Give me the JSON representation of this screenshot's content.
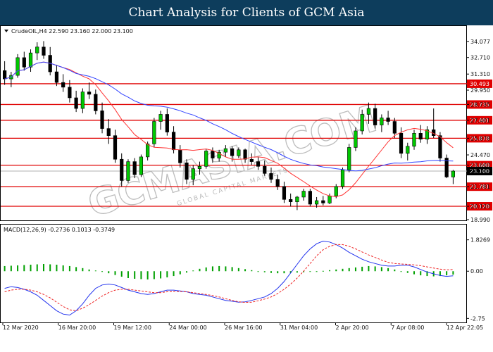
{
  "banner": {
    "title": "Chart Analysis for Clients of GCM Asia"
  },
  "chart_data": {
    "type": "candlestick",
    "symbol_header": "CrudeOIL,H4  22.590 23.160 22.000 23.100",
    "indicator_header": "MACD(12,26,9) -0.2736 0.1013 -0.3749",
    "watermark": "GCMASIA.COM",
    "watermark_sub": "GLOBAL CAPITAL MARKETS",
    "price_axis_ticks": [
      "34.077",
      "32.710",
      "31.310",
      "29.950",
      "28.735",
      "27.401",
      "25.878",
      "24.470",
      "23.600",
      "23.100",
      "21.781",
      "20.120",
      "18.990"
    ],
    "macd_axis_ticks": [
      "1.8269",
      "0.00",
      "-2.75"
    ],
    "x_tick_labels": [
      "12 Mar 2020",
      "16 Mar 20:00",
      "19 Mar 12:00",
      "24 Mar 00:00",
      "26 Mar 16:00",
      "31 Mar 04:00",
      "2 Apr 20:00",
      "7 Apr 08:00",
      "12 Apr 22:05"
    ],
    "ylim": [
      18.99,
      34.6
    ],
    "macd_ylim": [
      -2.9,
      2.1
    ],
    "horizontal_levels": [
      {
        "value": 30.493,
        "label": "30.493"
      },
      {
        "value": 28.735,
        "label": "28.735"
      },
      {
        "value": 27.401,
        "label": "27.401"
      },
      {
        "value": 25.878,
        "label": "25.878"
      },
      {
        "value": 23.6,
        "label": "23.600"
      },
      {
        "value": 21.781,
        "label": "21.781"
      },
      {
        "value": 20.12,
        "label": "20.120"
      }
    ],
    "current_price": {
      "value": 23.1,
      "label": "23.100"
    },
    "candles": [
      [
        31.6,
        32.4,
        30.4,
        30.9
      ],
      [
        30.9,
        31.5,
        30.2,
        31.2
      ],
      [
        31.2,
        33.0,
        31.0,
        32.7
      ],
      [
        32.7,
        33.2,
        31.6,
        31.9
      ],
      [
        31.9,
        33.4,
        31.5,
        33.1
      ],
      [
        33.1,
        34.0,
        32.5,
        33.6
      ],
      [
        33.6,
        34.1,
        32.6,
        32.9
      ],
      [
        32.9,
        33.6,
        31.2,
        31.5
      ],
      [
        31.5,
        32.1,
        30.3,
        30.6
      ],
      [
        30.6,
        31.3,
        29.8,
        30.2
      ],
      [
        30.2,
        30.8,
        28.9,
        29.3
      ],
      [
        29.3,
        29.9,
        28.1,
        28.4
      ],
      [
        28.4,
        30.1,
        28.0,
        29.8
      ],
      [
        29.8,
        30.6,
        29.2,
        29.6
      ],
      [
        29.6,
        30.0,
        27.9,
        28.2
      ],
      [
        28.2,
        28.9,
        26.3,
        26.7
      ],
      [
        26.7,
        27.5,
        25.4,
        26.1
      ],
      [
        26.1,
        26.6,
        23.8,
        24.1
      ],
      [
        24.1,
        24.6,
        21.8,
        22.3
      ],
      [
        22.3,
        24.1,
        22.1,
        23.9
      ],
      [
        23.9,
        24.2,
        22.5,
        22.8
      ],
      [
        22.8,
        24.5,
        22.6,
        24.3
      ],
      [
        24.3,
        25.6,
        24.0,
        25.4
      ],
      [
        25.4,
        27.6,
        25.1,
        27.3
      ],
      [
        27.3,
        28.2,
        26.6,
        27.9
      ],
      [
        27.9,
        28.4,
        26.1,
        26.4
      ],
      [
        26.4,
        26.9,
        24.6,
        24.9
      ],
      [
        24.9,
        25.3,
        23.4,
        23.8
      ],
      [
        23.8,
        24.1,
        22.0,
        22.4
      ],
      [
        22.4,
        23.6,
        21.9,
        23.3
      ],
      [
        23.3,
        23.9,
        22.8,
        23.5
      ],
      [
        23.5,
        25.0,
        23.3,
        24.8
      ],
      [
        24.8,
        25.1,
        23.8,
        24.2
      ],
      [
        24.2,
        24.9,
        23.9,
        24.7
      ],
      [
        24.7,
        25.3,
        24.3,
        25.0
      ],
      [
        25.0,
        25.2,
        23.9,
        24.4
      ],
      [
        24.4,
        25.1,
        24.2,
        24.9
      ],
      [
        24.9,
        25.0,
        23.8,
        24.1
      ],
      [
        24.1,
        24.6,
        23.6,
        23.9
      ],
      [
        23.9,
        24.3,
        23.2,
        23.5
      ],
      [
        23.5,
        24.0,
        22.7,
        22.9
      ],
      [
        22.9,
        23.4,
        22.1,
        22.4
      ],
      [
        22.4,
        22.8,
        21.5,
        21.8
      ],
      [
        21.8,
        22.2,
        20.4,
        20.7
      ],
      [
        20.7,
        21.2,
        20.1,
        20.5
      ],
      [
        20.5,
        21.0,
        19.8,
        20.9
      ],
      [
        20.9,
        21.6,
        20.6,
        21.4
      ],
      [
        21.4,
        21.6,
        20.1,
        20.3
      ],
      [
        20.3,
        20.9,
        20.0,
        20.6
      ],
      [
        20.6,
        21.0,
        20.2,
        20.4
      ],
      [
        20.4,
        21.2,
        20.3,
        21.0
      ],
      [
        21.0,
        22.0,
        20.8,
        21.8
      ],
      [
        21.8,
        23.4,
        21.6,
        23.2
      ],
      [
        23.2,
        25.4,
        23.0,
        25.1
      ],
      [
        25.1,
        26.8,
        24.8,
        26.5
      ],
      [
        26.5,
        28.3,
        26.2,
        27.9
      ],
      [
        27.9,
        28.9,
        27.1,
        28.4
      ],
      [
        28.4,
        28.8,
        26.7,
        27.0
      ],
      [
        27.0,
        27.9,
        26.4,
        27.6
      ],
      [
        27.6,
        28.2,
        27.0,
        27.3
      ],
      [
        27.3,
        27.6,
        25.9,
        26.3
      ],
      [
        26.3,
        26.8,
        24.2,
        24.6
      ],
      [
        24.6,
        25.5,
        24.0,
        25.2
      ],
      [
        25.2,
        26.6,
        24.9,
        26.3
      ],
      [
        26.3,
        27.0,
        25.5,
        25.8
      ],
      [
        25.8,
        26.9,
        25.4,
        26.6
      ],
      [
        26.6,
        28.4,
        25.9,
        26.1
      ],
      [
        26.1,
        26.4,
        23.9,
        24.2
      ],
      [
        24.2,
        24.5,
        22.5,
        22.6
      ],
      [
        22.6,
        23.2,
        22.0,
        23.1
      ]
    ],
    "moving_averages": [
      {
        "color": "#ff3333",
        "period": 10
      },
      {
        "color": "#3344ff",
        "period": 30
      }
    ],
    "macd_histogram": [
      0.3,
      0.32,
      0.34,
      0.36,
      0.38,
      0.4,
      0.42,
      0.4,
      0.38,
      0.34,
      0.3,
      0.24,
      0.18,
      0.1,
      0.04,
      -0.04,
      -0.12,
      -0.22,
      -0.32,
      -0.4,
      -0.44,
      -0.46,
      -0.48,
      -0.46,
      -0.42,
      -0.36,
      -0.28,
      -0.18,
      -0.08,
      0.04,
      0.14,
      0.22,
      0.28,
      0.3,
      0.28,
      0.24,
      0.18,
      0.12,
      0.06,
      0.0,
      -0.06,
      -0.1,
      -0.12,
      -0.12,
      -0.1,
      -0.08,
      -0.06,
      -0.04,
      -0.02,
      0.02,
      0.06,
      0.1,
      0.14,
      0.18,
      0.22,
      0.26,
      0.3,
      0.28,
      0.24,
      0.18,
      0.1,
      0.0,
      -0.1,
      -0.18,
      -0.24,
      -0.28,
      -0.3,
      -0.28,
      -0.24,
      -0.2
    ],
    "macd_line": [
      -1.0,
      -0.9,
      -0.95,
      -1.05,
      -1.2,
      -1.4,
      -1.7,
      -2.0,
      -2.3,
      -2.5,
      -2.55,
      -2.3,
      -1.9,
      -1.4,
      -1.0,
      -0.8,
      -0.75,
      -0.8,
      -0.95,
      -1.1,
      -1.2,
      -1.3,
      -1.35,
      -1.3,
      -1.2,
      -1.1,
      -1.1,
      -1.15,
      -1.2,
      -1.3,
      -1.35,
      -1.4,
      -1.5,
      -1.6,
      -1.7,
      -1.75,
      -1.8,
      -1.78,
      -1.7,
      -1.6,
      -1.5,
      -1.3,
      -1.0,
      -0.6,
      -0.1,
      0.4,
      0.9,
      1.3,
      1.6,
      1.75,
      1.7,
      1.55,
      1.35,
      1.1,
      0.9,
      0.7,
      0.55,
      0.45,
      0.35,
      0.3,
      0.3,
      0.35,
      0.35,
      0.25,
      0.1,
      -0.05,
      -0.15,
      -0.25,
      -0.3,
      -0.27
    ],
    "signal_line": [
      -1.2,
      -1.1,
      -1.05,
      -1.05,
      -1.1,
      -1.2,
      -1.35,
      -1.55,
      -1.8,
      -2.05,
      -2.25,
      -2.3,
      -2.15,
      -1.95,
      -1.7,
      -1.45,
      -1.25,
      -1.1,
      -1.05,
      -1.05,
      -1.1,
      -1.15,
      -1.2,
      -1.25,
      -1.25,
      -1.2,
      -1.18,
      -1.18,
      -1.2,
      -1.25,
      -1.3,
      -1.35,
      -1.42,
      -1.5,
      -1.6,
      -1.7,
      -1.78,
      -1.82,
      -1.8,
      -1.72,
      -1.62,
      -1.5,
      -1.3,
      -1.05,
      -0.75,
      -0.4,
      0.0,
      0.45,
      0.9,
      1.25,
      1.45,
      1.55,
      1.55,
      1.45,
      1.3,
      1.12,
      0.95,
      0.8,
      0.65,
      0.52,
      0.45,
      0.42,
      0.4,
      0.37,
      0.32,
      0.25,
      0.18,
      0.12,
      0.08,
      0.1
    ]
  }
}
